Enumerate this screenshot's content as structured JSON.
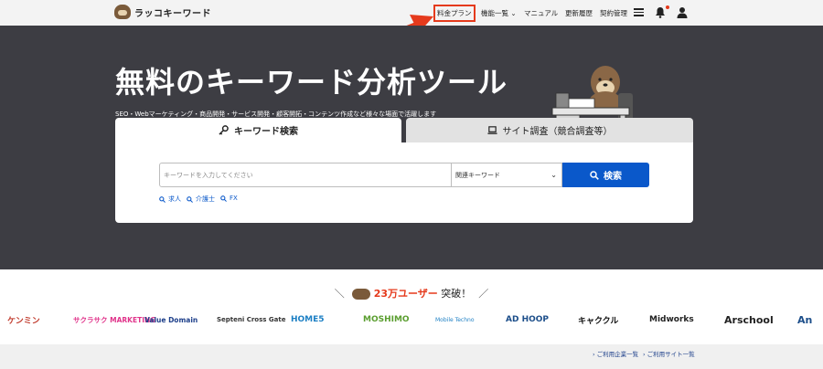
{
  "header": {
    "logo_text": "ラッコキーワード",
    "nav": {
      "pricing": "料金プラン",
      "features": "機能一覧",
      "manual": "マニュアル",
      "changelog": "更新履歴",
      "contract": "契約管理"
    },
    "icons": [
      "hamburger-icon",
      "bell-icon",
      "user-icon"
    ]
  },
  "hero": {
    "title": "無料のキーワード分析ツール",
    "subtitle": "SEO・Webマーケティング・商品開発・サービス開発・顧客開拓・コンテンツ作成など様々な場面で活躍します"
  },
  "tabs": {
    "keyword": "キーワード検索",
    "site": "サイト調査（競合調査等）"
  },
  "search": {
    "placeholder": "キーワードを入力してください",
    "select_value": "関連キーワード",
    "button": "検索",
    "quick_links": [
      "求人",
      "介護士",
      "FX"
    ]
  },
  "users": {
    "count": "23万ユーザー",
    "suffix": "突破！"
  },
  "companies": [
    "ケンミン",
    "サクラサク MARKETING",
    "Value Domain",
    "Septeni Cross Gate",
    "HOME5",
    "MOSHIMO",
    "Mobile Techno",
    "AD HOOP",
    "キャククル",
    "Midworks",
    "Arschool",
    "An"
  ],
  "footer": {
    "companies_link": "ご利用企業一覧",
    "sites_link": "ご利用サイト一覧"
  },
  "colors": {
    "accent_red": "#e53a1c",
    "primary_blue": "#0a58ca",
    "hero_bg": "#3d3d43"
  }
}
